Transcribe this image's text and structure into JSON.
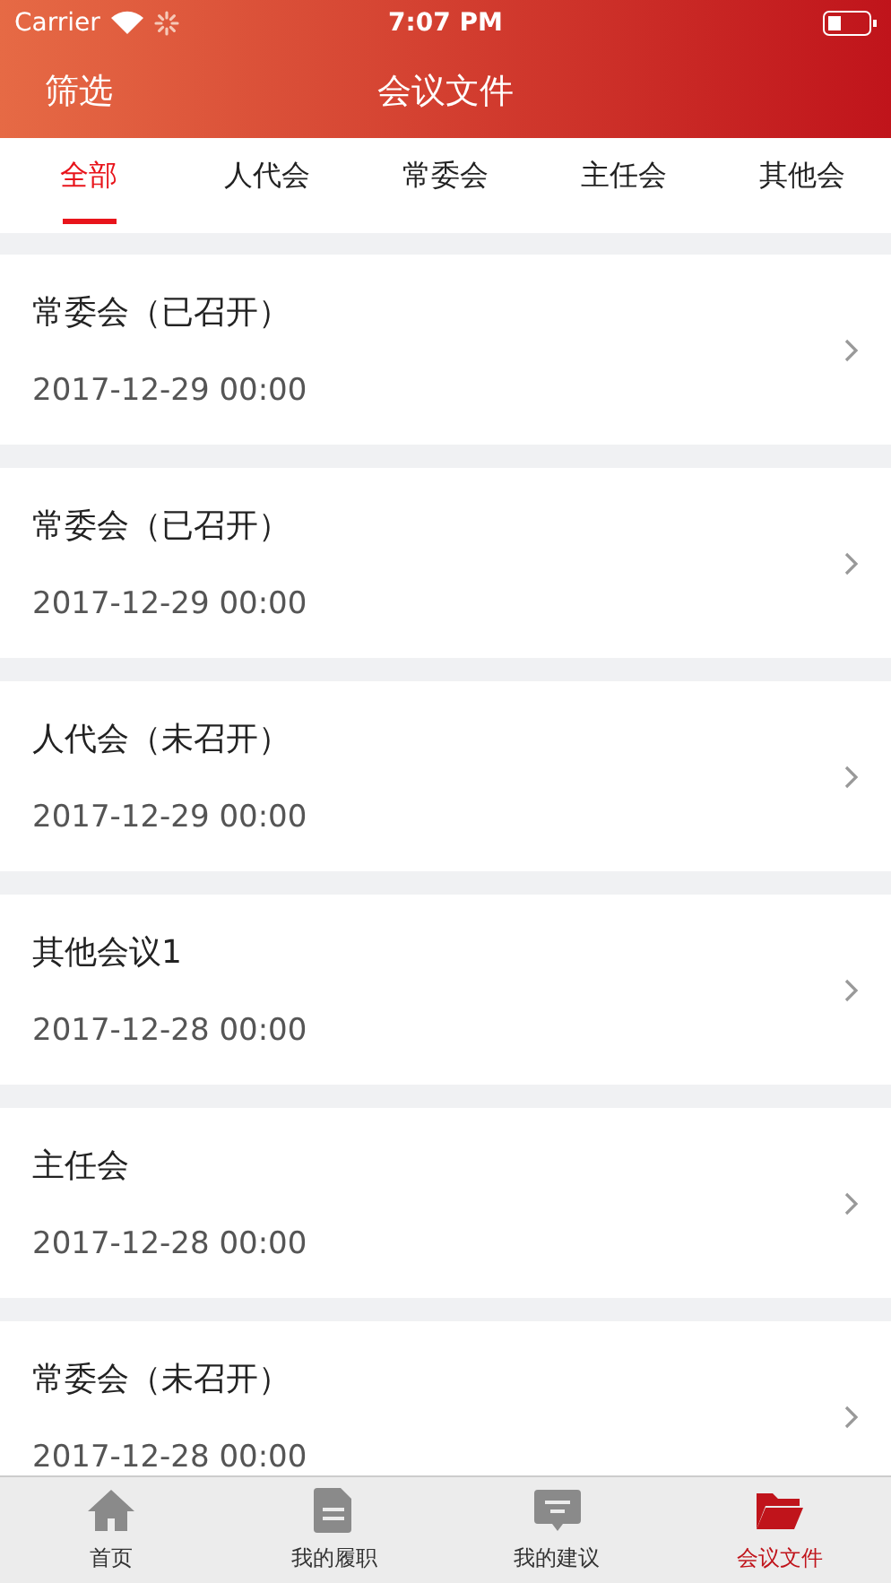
{
  "status_bar": {
    "carrier": "Carrier",
    "time": "7:07 PM"
  },
  "nav": {
    "left": "筛选",
    "title": "会议文件"
  },
  "tabs": [
    {
      "label": "全部",
      "selected": true
    },
    {
      "label": "人代会",
      "selected": false
    },
    {
      "label": "常委会",
      "selected": false
    },
    {
      "label": "主任会",
      "selected": false
    },
    {
      "label": "其他会",
      "selected": false
    }
  ],
  "meetings": [
    {
      "title": "常委会（已召开）",
      "date": "2017-12-29 00:00"
    },
    {
      "title": "常委会（已召开）",
      "date": "2017-12-29 00:00"
    },
    {
      "title": "人代会（未召开）",
      "date": "2017-12-29 00:00"
    },
    {
      "title": "其他会议1",
      "date": "2017-12-28 00:00"
    },
    {
      "title": "主任会",
      "date": "2017-12-28 00:00"
    },
    {
      "title": "常委会（未召开）",
      "date": "2017-12-28 00:00"
    }
  ],
  "tab_bar": [
    {
      "kind": "home",
      "label": "首页",
      "selected": false
    },
    {
      "kind": "document",
      "label": "我的履职",
      "selected": false
    },
    {
      "kind": "message",
      "label": "我的建议",
      "selected": false
    },
    {
      "kind": "folder",
      "label": "会议文件",
      "selected": true
    }
  ]
}
